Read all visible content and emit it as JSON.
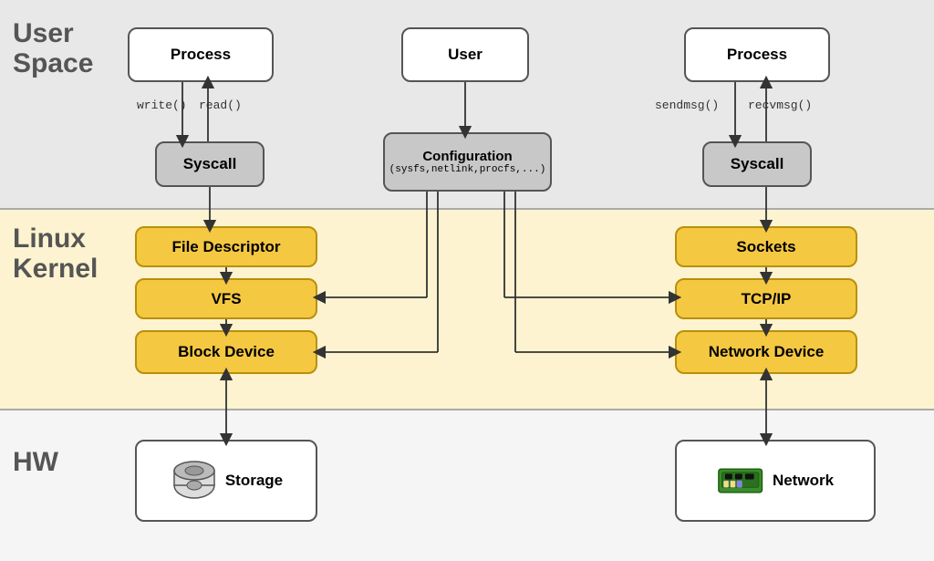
{
  "layers": {
    "user_space": "User\nSpace",
    "linux_kernel": "Linux\nKernel",
    "hw": "HW"
  },
  "boxes": {
    "process_left": "Process",
    "process_right": "Process",
    "user_center": "User",
    "syscall_left": "Syscall",
    "syscall_right": "Syscall",
    "configuration": "Configuration\n(sysfs,netlink,procfs,...)",
    "file_descriptor": "File Descriptor",
    "vfs": "VFS",
    "block_device": "Block Device",
    "sockets": "Sockets",
    "tcp_ip": "TCP/IP",
    "network_device": "Network Device",
    "storage": "Storage",
    "network": "Network"
  },
  "code_labels": {
    "write": "write()",
    "read": "read()",
    "sendmsg": "sendmsg()",
    "recvmsg": "recvmsg()"
  }
}
